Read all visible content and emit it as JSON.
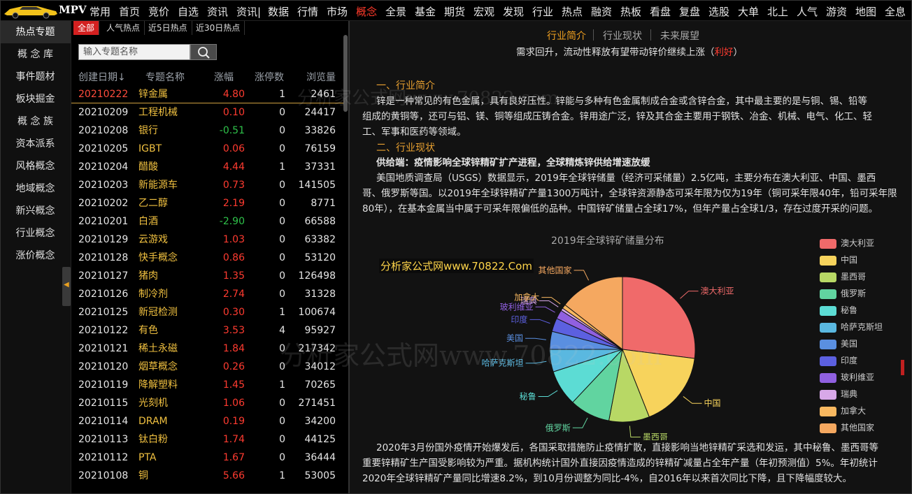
{
  "topnav": {
    "logo_text": "MPV",
    "items": [
      "常用",
      "首页",
      "竞价",
      "自选",
      "资讯",
      "资讯|",
      "数据",
      "行情",
      "市场",
      "概念",
      "全景",
      "基金",
      "期货",
      "宏观",
      "发现",
      "行业",
      "热点",
      "融资",
      "热板",
      "看盘",
      "复盘",
      "选股",
      "大单",
      "北上",
      "人气",
      "游资",
      "地图",
      "全息"
    ],
    "active_index": 9
  },
  "sidebar": {
    "items": [
      "热点专题",
      "概 念 库",
      "事件题材",
      "板块掘金",
      "概 念 族",
      "资本派系",
      "风格概念",
      "地域概念",
      "新兴概念",
      "行业概念",
      "涨价概念"
    ],
    "active_index": 0
  },
  "list": {
    "subtabs": [
      "全部",
      "人气热点",
      "近5日热点",
      "近30日热点"
    ],
    "active_subtab": 0,
    "search_placeholder": "输入专题名称",
    "headers": {
      "date": "创建日期↓",
      "name": "专题名称",
      "pct": "涨幅",
      "limit": "涨停数",
      "views": "浏览量"
    },
    "rows": [
      {
        "date": "20210222",
        "name": "锌金属",
        "pct": "4.80",
        "dir": "up",
        "limit": "1",
        "views": "2461"
      },
      {
        "date": "20210209",
        "name": "工程机械",
        "pct": "0.10",
        "dir": "up",
        "limit": "0",
        "views": "24417"
      },
      {
        "date": "20210208",
        "name": "银行",
        "pct": "-0.51",
        "dir": "down",
        "limit": "0",
        "views": "33826"
      },
      {
        "date": "20210205",
        "name": "IGBT",
        "pct": "0.06",
        "dir": "up",
        "limit": "0",
        "views": "76159"
      },
      {
        "date": "20210204",
        "name": "醋酸",
        "pct": "4.44",
        "dir": "up",
        "limit": "1",
        "views": "37331"
      },
      {
        "date": "20210203",
        "name": "新能源车",
        "pct": "0.73",
        "dir": "up",
        "limit": "0",
        "views": "141505"
      },
      {
        "date": "20210202",
        "name": "乙二醇",
        "pct": "2.19",
        "dir": "up",
        "limit": "0",
        "views": "8771"
      },
      {
        "date": "20210201",
        "name": "白酒",
        "pct": "-2.90",
        "dir": "down",
        "limit": "0",
        "views": "66588"
      },
      {
        "date": "20210129",
        "name": "云游戏",
        "pct": "1.03",
        "dir": "up",
        "limit": "0",
        "views": "63382"
      },
      {
        "date": "20210128",
        "name": "快手概念",
        "pct": "0.86",
        "dir": "up",
        "limit": "0",
        "views": "53120"
      },
      {
        "date": "20210127",
        "name": "猪肉",
        "pct": "1.35",
        "dir": "up",
        "limit": "0",
        "views": "126498"
      },
      {
        "date": "20210126",
        "name": "制冷剂",
        "pct": "2.74",
        "dir": "up",
        "limit": "0",
        "views": "31328"
      },
      {
        "date": "20210125",
        "name": "新冠检测",
        "pct": "0.30",
        "dir": "up",
        "limit": "1",
        "views": "100674"
      },
      {
        "date": "20210122",
        "name": "有色",
        "pct": "3.53",
        "dir": "up",
        "limit": "4",
        "views": "95927"
      },
      {
        "date": "20210121",
        "name": "稀土永磁",
        "pct": "1.84",
        "dir": "up",
        "limit": "0",
        "views": "217342"
      },
      {
        "date": "20210120",
        "name": "烟草概念",
        "pct": "0.26",
        "dir": "up",
        "limit": "0",
        "views": "34012"
      },
      {
        "date": "20210119",
        "name": "降解塑料",
        "pct": "1.45",
        "dir": "up",
        "limit": "1",
        "views": "70265"
      },
      {
        "date": "20210115",
        "name": "光刻机",
        "pct": "1.06",
        "dir": "up",
        "limit": "0",
        "views": "271451"
      },
      {
        "date": "20210114",
        "name": "DRAM",
        "pct": "0.19",
        "dir": "up",
        "limit": "0",
        "views": "34200"
      },
      {
        "date": "20210113",
        "name": "钛白粉",
        "pct": "1.74",
        "dir": "up",
        "limit": "0",
        "views": "44125"
      },
      {
        "date": "20210112",
        "name": "PTA",
        "pct": "1.67",
        "dir": "up",
        "limit": "0",
        "views": "36444"
      },
      {
        "date": "20210108",
        "name": "铜",
        "pct": "5.66",
        "dir": "up",
        "limit": "1",
        "views": "53005"
      }
    ]
  },
  "content": {
    "tabs": [
      "行业简介",
      "行业现状",
      "未来展望"
    ],
    "active_tab": 0,
    "headline": "需求回升，流动性释放有望带动锌价继续上涨（",
    "headline_tag": "利好",
    "headline_close": "）",
    "sec1_title": "一、行业简介",
    "sec1_lines": [
      "锌是一种常见的有色金属，具有良好压性。锌能与多种有色金属制成合金或含锌合金，其中最主要的是与铜、锡、铅等",
      "组成的黄铜等，还可与铝、镁、铜等组成压铸合金。锌用途广泛，锌及其合金主要用于钢铁、冶金、机械、电气、化工、轻",
      "工、军事和医药等领域。"
    ],
    "sec2_title": "二、行业现状",
    "supply_line": "供给端：疫情影响全球锌精矿扩产进程，全球精炼锌供给增速放缓",
    "sec2_lines": [
      "美国地质调查局（USGS）数据显示，2019年全球锌储量（经济可采储量）2.5亿吨，主要分布在澳大利亚、中国、墨西",
      "哥、俄罗斯等国。以2019年全球锌精矿产量1300万吨计，全球锌资源静态可采年限为仅为19年（铜可采年限40年，铅可采年限",
      "80年），在基本金属当中属于可采年限偏低的品种。中国锌矿储量占全球17%，但年产量占全球1/3，存在过度开采的问题。"
    ],
    "bottom_lines": [
      "2020年3月份国外疫情开始爆发后，各国采取措施防止疫情扩散，直接影响当地锌精矿采选和发运，其中秘鲁、墨西哥等",
      "重要锌精矿生产国受影响较为严重。据机构统计国外直接因疫情造成的锌精矿减量占全年产量（年初预测值）5%。年初统计",
      "2020年全球锌精矿产量同比增速8.2%，到10月份调整为同比-4%，自2016年以来首次同比下降，且下降幅度较大。"
    ],
    "watermark_label": "分析家公式网www.70822.Com"
  },
  "watermarks": [
    "分析家公式网www.70822.com",
    "分析家公式网www.70822.com"
  ],
  "chart_data": {
    "type": "pie",
    "title": "2019年全球锌矿储量分布",
    "legend_position": "right",
    "categories": [
      "澳大利亚",
      "中国",
      "墨西哥",
      "俄罗斯",
      "秘鲁",
      "哈萨克斯坦",
      "美国",
      "印度",
      "玻利维亚",
      "瑞典",
      "加拿大",
      "其他国家"
    ],
    "values": [
      27,
      17,
      9,
      9,
      8,
      5,
      4,
      3,
      2,
      0.6,
      0.9,
      14.5
    ],
    "colors": [
      "#f06a6a",
      "#f7d35c",
      "#b8d865",
      "#61d4a0",
      "#5cdcd4",
      "#5ab8e0",
      "#5a8fe0",
      "#5c60e0",
      "#9060e0",
      "#d8a8e8",
      "#f8b860",
      "#f5a860"
    ]
  }
}
